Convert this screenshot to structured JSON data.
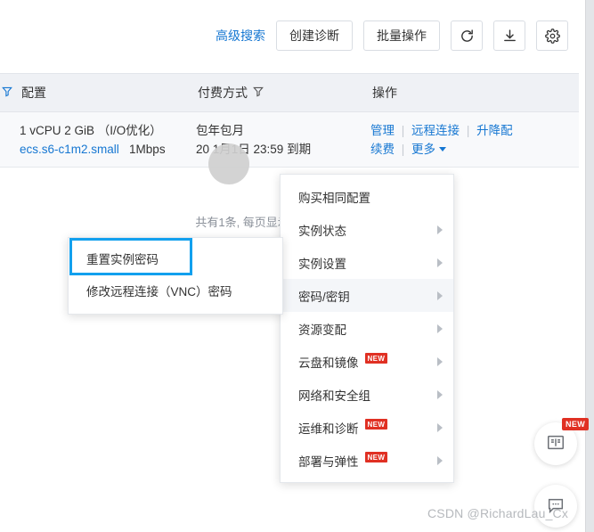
{
  "toolbar": {
    "advanced_search": "高级搜索",
    "create_diagnosis": "创建诊断",
    "batch_operation": "批量操作",
    "refresh_icon": "refresh-icon",
    "download_icon": "download-icon",
    "settings_icon": "gear-icon"
  },
  "table": {
    "headers": {
      "filter_icon": "filter-icon",
      "config": "配置",
      "pay_type": "付费方式",
      "pay_filter_icon": "filter-icon",
      "operations": "操作"
    },
    "row": {
      "spec": "1 vCPU 2 GiB （I/O优化）",
      "instance_type": "ecs.s6-c1m2.small",
      "bandwidth": "1Mbps",
      "pay_type": "包年包月",
      "expire": "20    1月1日 23:59 到期",
      "actions": {
        "manage": "管理",
        "remote_connect": "远程连接",
        "upgrade": "升降配",
        "renew": "续费",
        "more": "更多"
      }
    }
  },
  "pagination": {
    "summary": "共有1条, 每页显示:",
    "page_value": "",
    "next_label": "›",
    "last_label": "»"
  },
  "menu": {
    "items": [
      {
        "label": "购买相同配置",
        "has_arrow": false,
        "is_new": false,
        "active": false
      },
      {
        "label": "实例状态",
        "has_arrow": true,
        "is_new": false,
        "active": false
      },
      {
        "label": "实例设置",
        "has_arrow": true,
        "is_new": false,
        "active": false
      },
      {
        "label": "密码/密钥",
        "has_arrow": true,
        "is_new": false,
        "active": true
      },
      {
        "label": "资源变配",
        "has_arrow": true,
        "is_new": false,
        "active": false
      },
      {
        "label": "云盘和镜像",
        "has_arrow": true,
        "is_new": true,
        "active": false
      },
      {
        "label": "网络和安全组",
        "has_arrow": true,
        "is_new": false,
        "active": false
      },
      {
        "label": "运维和诊断",
        "has_arrow": true,
        "is_new": true,
        "active": false
      },
      {
        "label": "部署与弹性",
        "has_arrow": true,
        "is_new": true,
        "active": false
      }
    ],
    "new_badge_text": "NEW"
  },
  "submenu": {
    "items": [
      {
        "label": "重置实例密码"
      },
      {
        "label": "修改远程连接（VNC）密码"
      }
    ]
  },
  "floating": {
    "doc_icon": "manual-book-icon",
    "chat_icon": "chat-bubble-icon",
    "new_badge_text": "NEW"
  },
  "watermark": "CSDN @RichardLau_Cx",
  "colors": {
    "link_blue": "#1677d2",
    "highlight_blue": "#12a0ee",
    "badge_red": "#e03023",
    "header_bg": "#eff1f5"
  }
}
